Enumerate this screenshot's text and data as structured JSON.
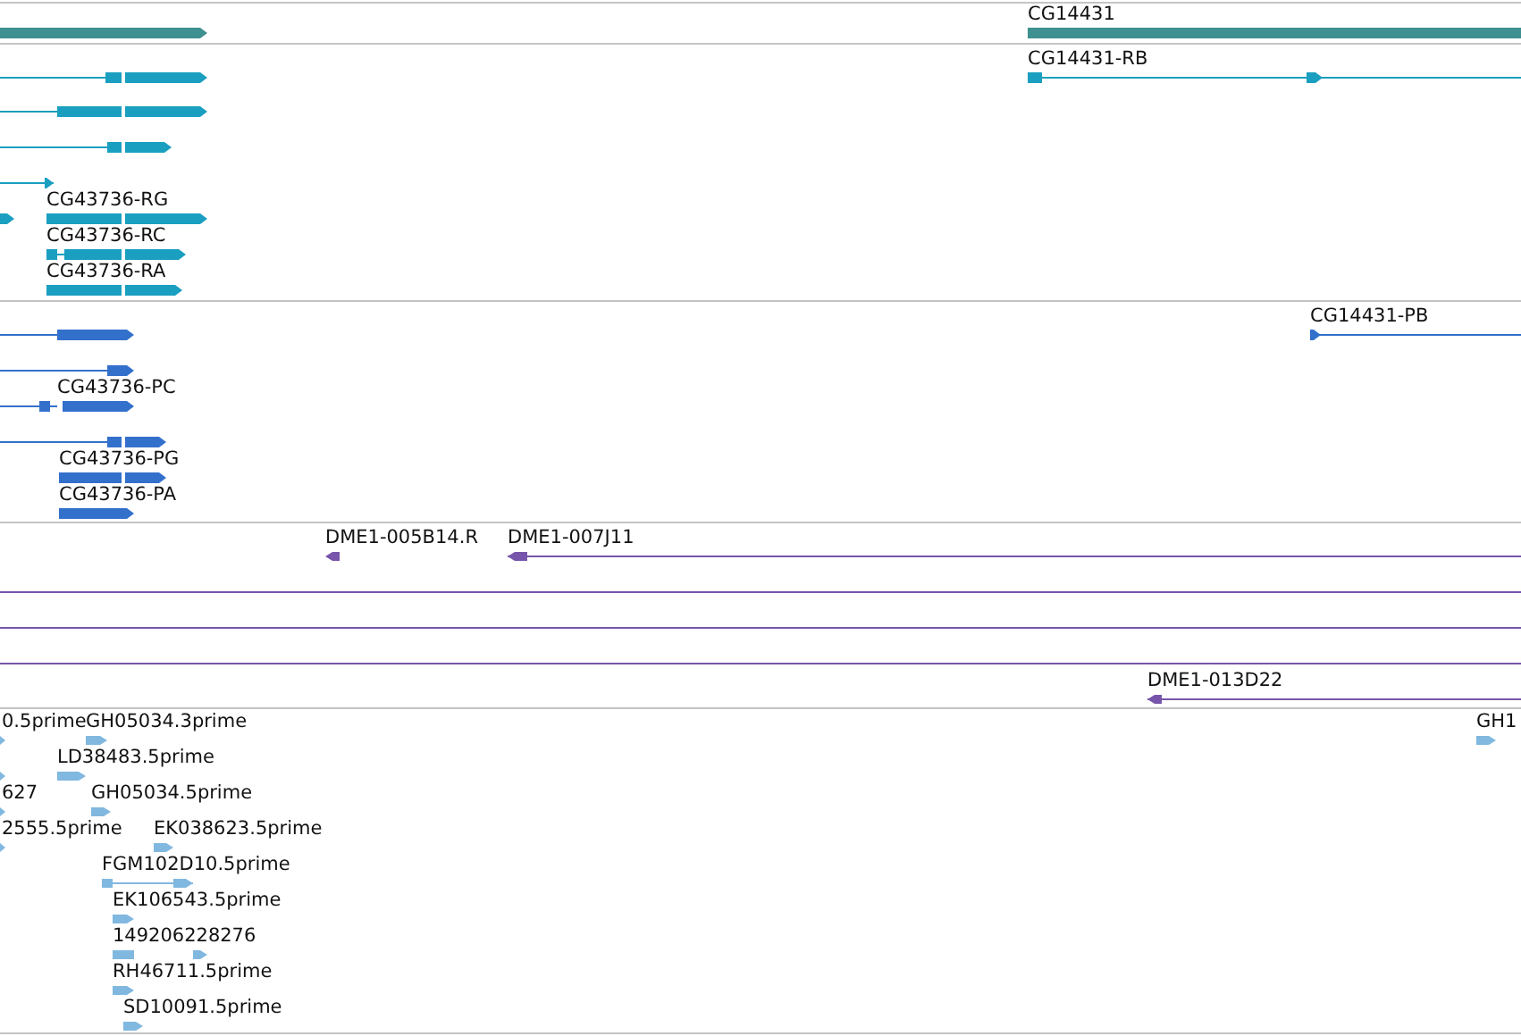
{
  "tracks": [
    {
      "kind": "gene",
      "color": "#3f9090",
      "features": [
        {
          "reverse": false
        },
        {
          "label": "CG14431",
          "reverse": false
        }
      ]
    },
    {
      "kind": "transcript",
      "color": "#1a9fc0",
      "features": [
        {
          "reverse": false
        },
        {
          "reverse": false
        },
        {
          "reverse": false
        },
        {
          "reverse": false
        },
        {
          "reverse": false
        },
        {
          "label": "CG43736-RG",
          "reverse": false
        },
        {
          "label": "CG43736-RC",
          "reverse": false
        },
        {
          "label": "CG43736-RA",
          "reverse": false
        },
        {
          "label": "CG14431-RB",
          "reverse": false
        }
      ]
    },
    {
      "kind": "protein",
      "color": "#3370cc",
      "features": [
        {
          "reverse": false
        },
        {
          "reverse": false
        },
        {
          "label": "CG43736-PC",
          "reverse": false
        },
        {
          "reverse": false
        },
        {
          "label": "CG43736-PG",
          "reverse": false
        },
        {
          "label": "CG43736-PA",
          "reverse": false
        },
        {
          "label": "CG14431-PB",
          "reverse": false
        }
      ]
    },
    {
      "kind": "clone",
      "color": "#7755aa",
      "features": [
        {
          "label": "DME1-005B14.R",
          "reverse": true
        },
        {
          "label": "DME1-007J11",
          "reverse": true
        },
        {
          "kind": "span"
        },
        {
          "kind": "span"
        },
        {
          "kind": "span"
        },
        {
          "label": "DME1-013D22",
          "reverse": true
        }
      ]
    },
    {
      "kind": "est",
      "color": "#80b8e0",
      "features": [
        {
          "label": "0.5prime",
          "reverse": false
        },
        {
          "label": "GH05034.3prime",
          "reverse": false
        },
        {
          "label": "GH1",
          "reverse": false
        },
        {
          "label": "LD38483.5prime",
          "reverse": false
        },
        {
          "reverse": false
        },
        {
          "label": "627",
          "reverse": false
        },
        {
          "label": "GH05034.5prime",
          "reverse": false
        },
        {
          "label": "2555.5prime",
          "reverse": false
        },
        {
          "label": "EK038623.5prime",
          "reverse": false
        },
        {
          "label": "FGM102D10.5prime",
          "reverse": false
        },
        {
          "label": "EK106543.5prime",
          "reverse": false
        },
        {
          "label": "149206228276",
          "reverse": false
        },
        {
          "label": "RH46711.5prime",
          "reverse": false
        },
        {
          "label": "SD10091.5prime",
          "reverse": false
        }
      ]
    }
  ]
}
